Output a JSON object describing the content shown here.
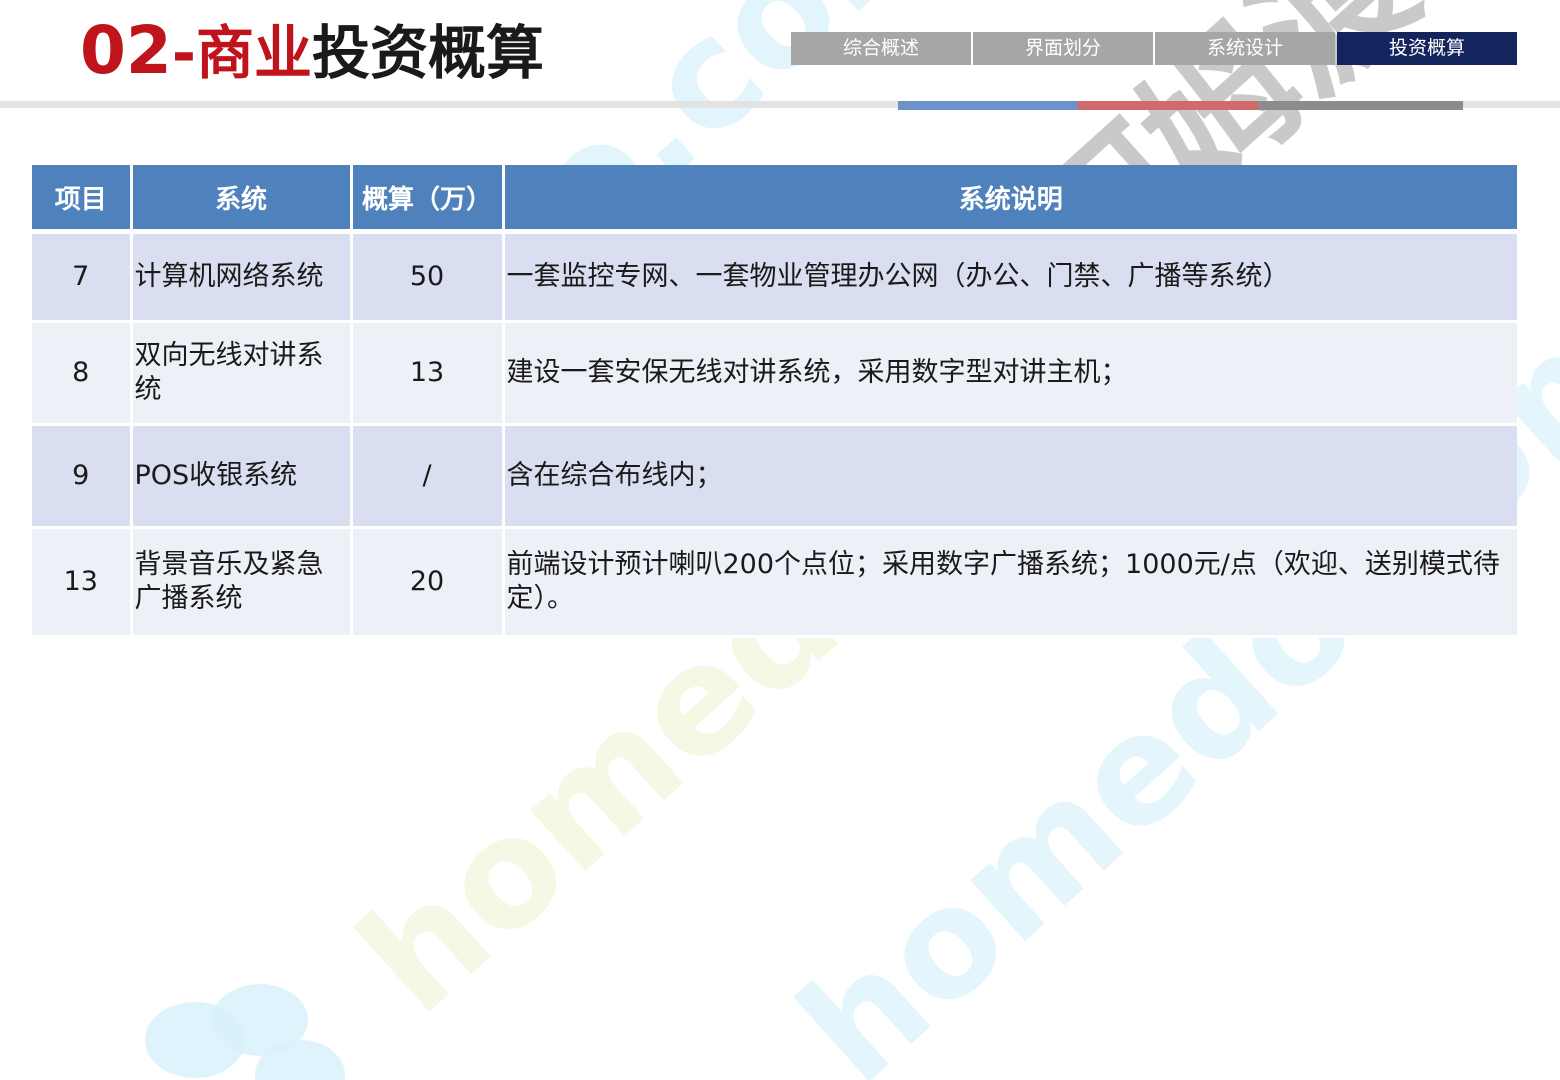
{
  "header": {
    "title_number": "02",
    "title_separator": "-",
    "title_red": "商业",
    "title_black": "投资概算",
    "nav_tabs": [
      {
        "label": "综合概述",
        "active": false
      },
      {
        "label": "界面划分",
        "active": false
      },
      {
        "label": "系统设计",
        "active": false
      },
      {
        "label": "投资概算",
        "active": true
      }
    ]
  },
  "colors": {
    "title_red": "#c0141c",
    "active_tab": "#13255c",
    "inactive_tab": "#a6a6a6",
    "table_header": "#4f81bd",
    "row_odd": "#d9dff0",
    "row_even": "#eef0f8",
    "progress_blue": "#6b93c9",
    "progress_red": "#cf6b6b",
    "progress_gray": "#8c8c8c"
  },
  "table": {
    "headers": [
      "项目",
      "系统",
      "概算（万）",
      "系统说明"
    ],
    "rows": [
      {
        "item": "7",
        "system": "计算机网络系统",
        "budget": "50",
        "description": "一套监控专网、一套物业管理办公网（办公、门禁、广播等系统）"
      },
      {
        "item": "8",
        "system": "双向无线对讲系统",
        "budget": "13",
        "description": "建设一套安保无线对讲系统，采用数字型对讲主机；"
      },
      {
        "item": "9",
        "system": "POS收银系统",
        "budget": "/",
        "description": "含在综合布线内；"
      },
      {
        "item": "13",
        "system": "背景音乐及紧急广播系统",
        "budget": "20",
        "description": "前端设计预计喇叭200个点位；采用数字广播系统；1000元/点（欢迎、送别模式待定）。"
      }
    ]
  },
  "watermark": {
    "text": "homedo.com",
    "cn_text": "河姆渡"
  }
}
